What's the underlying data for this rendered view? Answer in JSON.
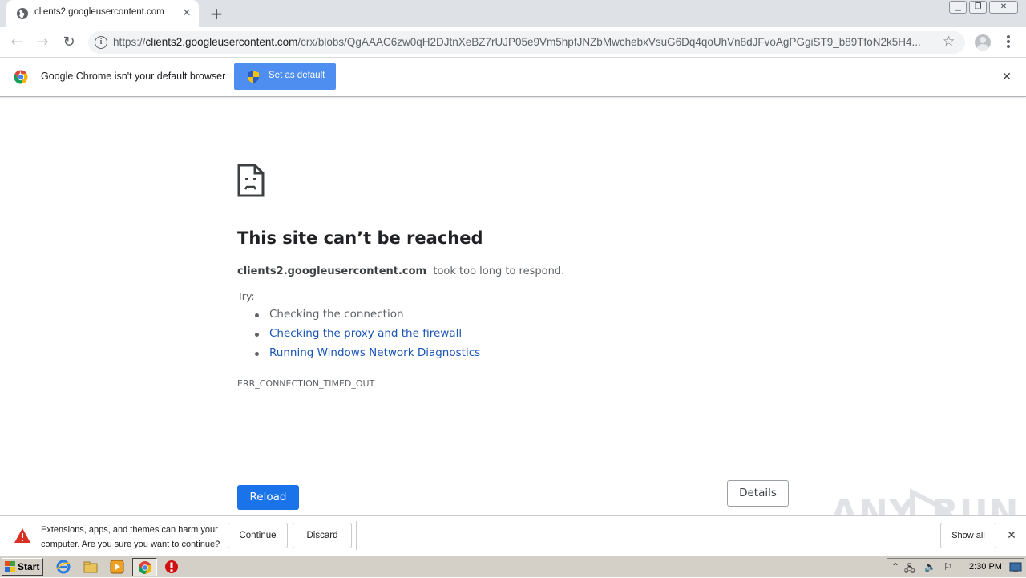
{
  "browser": {
    "tab": {
      "title": "clients2.googleusercontent.com",
      "favicon": "globe-icon"
    },
    "new_tab_label": "+",
    "url_host": "clients2.googleusercontent.com",
    "url_scheme": "https://",
    "url_path": "/crx/blobs/QgAAAC6zw0qH2DJtnXeBZ7rUJP05e9Vm5hpfJNZbMwchebxVsuG6Dq4qoUhVn8dJFvoAgPGgiST9_b89TfoN2k5H4..."
  },
  "infobar": {
    "message": "Google Chrome isn't your default browser",
    "button": "Set as default"
  },
  "error": {
    "title": "This site can’t be reached",
    "host": "clients2.googleusercontent.com",
    "description": "took too long to respond.",
    "try_label": "Try:",
    "suggestions": [
      {
        "text": "Checking the connection",
        "link": false
      },
      {
        "text": "Checking the proxy and the firewall",
        "link": true
      },
      {
        "text": "Running Windows Network Diagnostics",
        "link": true
      }
    ],
    "code": "ERR_CONNECTION_TIMED_OUT",
    "reload_label": "Reload",
    "details_label": "Details"
  },
  "watermark": {
    "text_left": "ANY",
    "text_right": "RUN"
  },
  "shelf": {
    "warning_line1": "Extensions, apps, and themes can harm your",
    "warning_line2": "computer. Are you sure you want to continue?",
    "continue_label": "Continue",
    "discard_label": "Discard",
    "show_all_label": "Show all"
  },
  "taskbar": {
    "start_label": "Start",
    "clock": "2:30 PM"
  },
  "colors": {
    "accent": "#1a73e8",
    "set_default_button": "#4d8ef0",
    "link": "#1a55b5",
    "warning": "#d93025"
  }
}
